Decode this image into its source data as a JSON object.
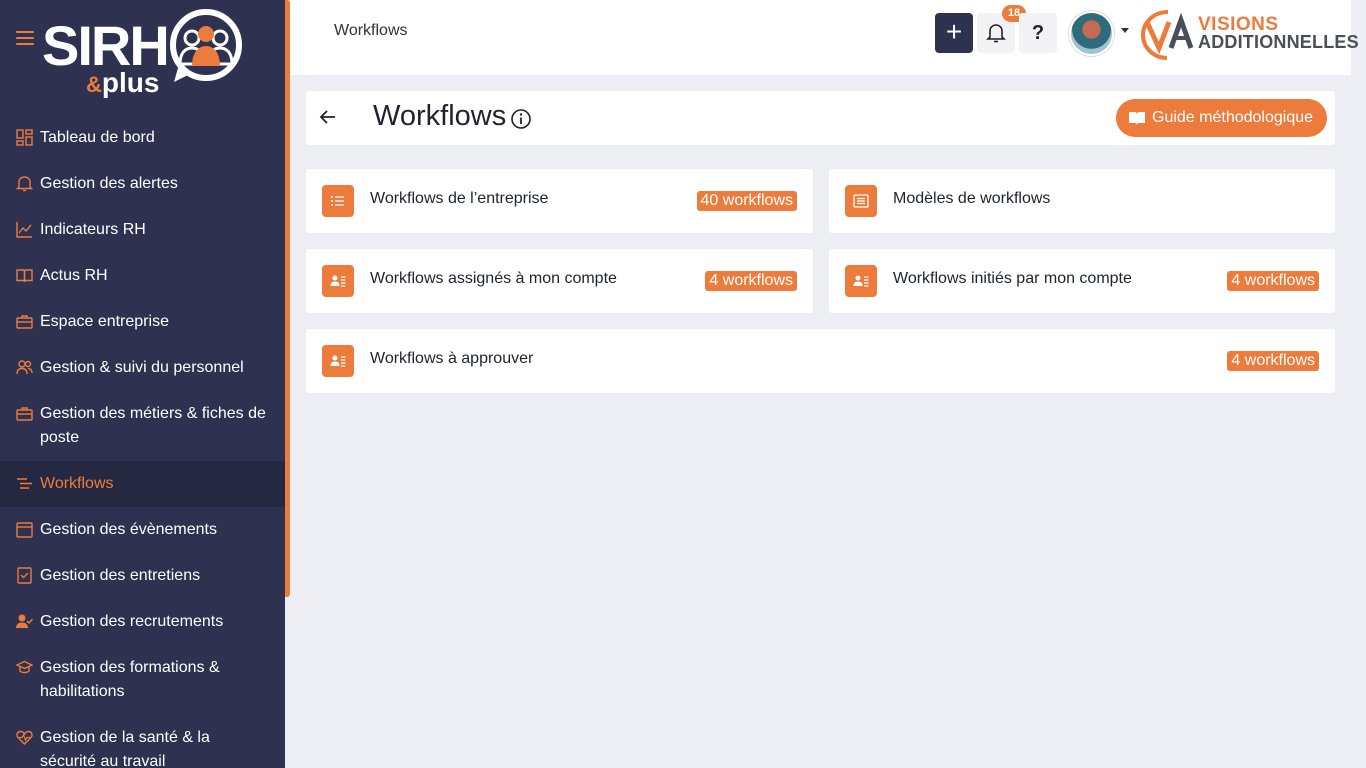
{
  "app": {
    "logo_text": "SIRH",
    "logo_sub_amp": "&",
    "logo_sub": "plus"
  },
  "sidebar": {
    "items": [
      {
        "label": "Tableau de bord",
        "icon": "dashboard-icon"
      },
      {
        "label": "Gestion des alertes",
        "icon": "bell-icon"
      },
      {
        "label": "Indicateurs RH",
        "icon": "chart-line-icon"
      },
      {
        "label": "Actus RH",
        "icon": "book-open-icon"
      },
      {
        "label": "Espace entreprise",
        "icon": "briefcase-icon"
      },
      {
        "label": "Gestion & suivi du personnel",
        "icon": "people-icon"
      },
      {
        "label": "Gestion des métiers & fiches de poste",
        "icon": "briefcase-icon"
      },
      {
        "label": "Workflows",
        "icon": "workflow-icon",
        "active": true
      },
      {
        "label": "Gestion des évènements",
        "icon": "calendar-icon"
      },
      {
        "label": "Gestion des entretiens",
        "icon": "checklist-icon"
      },
      {
        "label": "Gestion des recrutements",
        "icon": "user-check-icon"
      },
      {
        "label": "Gestion des formations & habilitations",
        "icon": "graduation-cap-icon"
      },
      {
        "label": "Gestion de la santé & la sécurité au travail",
        "icon": "heart-pulse-icon"
      }
    ]
  },
  "header": {
    "breadcrumb": "Workflows",
    "add_label": "+",
    "notification_count": "18",
    "help_label": "?",
    "brand_line1": "VISIONS",
    "brand_line2": "ADDITIONNELLES"
  },
  "main": {
    "title": "Workflows",
    "guide_button": "Guide méthodologique",
    "cards": [
      {
        "label": "Workflows de l’entreprise",
        "badge": "40 workflows",
        "icon": "list-icon"
      },
      {
        "label": "Modèles de workflows",
        "badge": "",
        "icon": "template-icon"
      },
      {
        "label": "Workflows assignés à mon compte",
        "badge": "4 workflows",
        "icon": "contact-card-icon"
      },
      {
        "label": "Workflows initiés par mon compte",
        "badge": "4 workflows",
        "icon": "contact-card-icon"
      },
      {
        "label": "Workflows à approuver",
        "badge": "4 workflows",
        "icon": "contact-card-icon"
      }
    ]
  },
  "colors": {
    "accent": "#ed7b3c",
    "sidebar_bg": "#2e3250",
    "sidebar_active_bg": "#252841",
    "page_bg": "#edeef3"
  }
}
